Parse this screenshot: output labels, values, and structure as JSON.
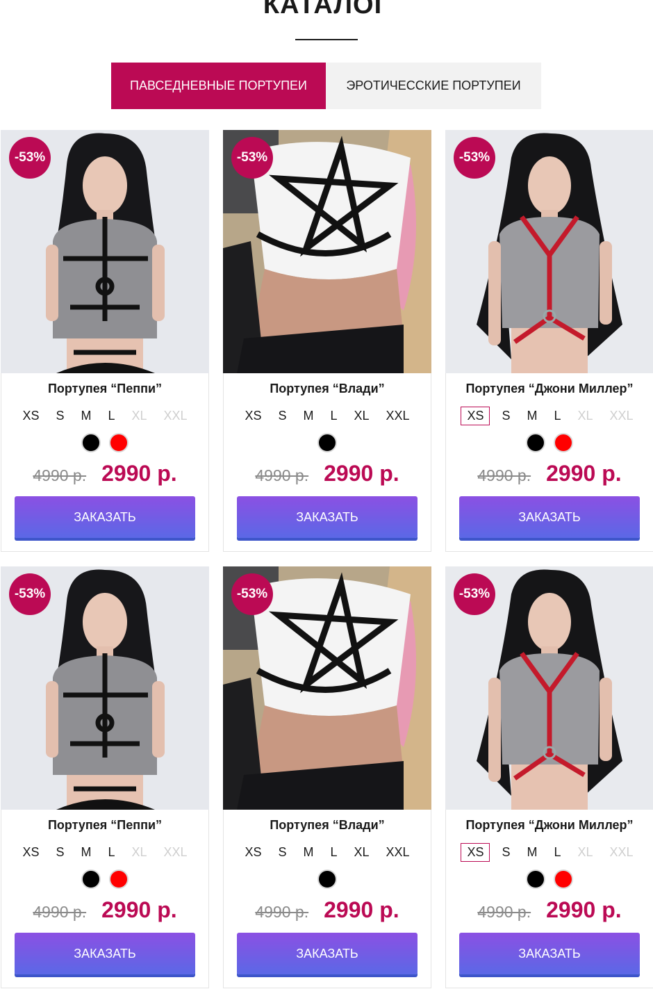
{
  "page": {
    "title": "КАТАЛОГ"
  },
  "tabs": [
    {
      "label": "ПАВСЕДНЕВНЫЕ ПОРТУПЕИ",
      "active": true
    },
    {
      "label": "ЭРОТИЧЕССКИЕ ПОРТУПЕИ",
      "active": false
    }
  ],
  "colors": {
    "accent": "#bb0a54",
    "button_top": "#8b50e3",
    "button_bottom": "#5b68e6"
  },
  "products": [
    {
      "discount": "-53%",
      "name": "Портупея “Пеппи”",
      "image": "model-gray-top-black-harness",
      "sizes": [
        {
          "label": "XS",
          "available": true,
          "selected": false
        },
        {
          "label": "S",
          "available": true,
          "selected": false
        },
        {
          "label": "M",
          "available": true,
          "selected": false
        },
        {
          "label": "L",
          "available": true,
          "selected": false
        },
        {
          "label": "XL",
          "available": false,
          "selected": false
        },
        {
          "label": "XXL",
          "available": false,
          "selected": false
        }
      ],
      "colors": [
        "#000000",
        "#ff0000"
      ],
      "old_price": "4990 р.",
      "new_price": "2990 р.",
      "button": "ЗАКАЗАТЬ"
    },
    {
      "discount": "-53%",
      "name": "Портупея “Влади”",
      "image": "model-white-top-pentagram-harness",
      "sizes": [
        {
          "label": "XS",
          "available": true,
          "selected": false
        },
        {
          "label": "S",
          "available": true,
          "selected": false
        },
        {
          "label": "M",
          "available": true,
          "selected": false
        },
        {
          "label": "L",
          "available": true,
          "selected": false
        },
        {
          "label": "XL",
          "available": true,
          "selected": false
        },
        {
          "label": "XXL",
          "available": true,
          "selected": false
        }
      ],
      "colors": [
        "#000000"
      ],
      "old_price": "4990 р.",
      "new_price": "2990 р.",
      "button": "ЗАКАЗАТЬ"
    },
    {
      "discount": "-53%",
      "name": "Портупея “Джони Миллер”",
      "image": "model-gray-top-red-harness",
      "sizes": [
        {
          "label": "XS",
          "available": true,
          "selected": true
        },
        {
          "label": "S",
          "available": true,
          "selected": false
        },
        {
          "label": "M",
          "available": true,
          "selected": false
        },
        {
          "label": "L",
          "available": true,
          "selected": false
        },
        {
          "label": "XL",
          "available": false,
          "selected": false
        },
        {
          "label": "XXL",
          "available": false,
          "selected": false
        }
      ],
      "colors": [
        "#000000",
        "#ff0000"
      ],
      "old_price": "4990 р.",
      "new_price": "2990 р.",
      "button": "ЗАКАЗАТЬ"
    },
    {
      "discount": "-53%",
      "name": "Портупея “Пеппи”",
      "image": "model-gray-top-black-harness",
      "sizes": [
        {
          "label": "XS",
          "available": true,
          "selected": false
        },
        {
          "label": "S",
          "available": true,
          "selected": false
        },
        {
          "label": "M",
          "available": true,
          "selected": false
        },
        {
          "label": "L",
          "available": true,
          "selected": false
        },
        {
          "label": "XL",
          "available": false,
          "selected": false
        },
        {
          "label": "XXL",
          "available": false,
          "selected": false
        }
      ],
      "colors": [
        "#000000",
        "#ff0000"
      ],
      "old_price": "4990 р.",
      "new_price": "2990 р.",
      "button": "ЗАКАЗАТЬ"
    },
    {
      "discount": "-53%",
      "name": "Портупея “Влади”",
      "image": "model-white-top-pentagram-harness",
      "sizes": [
        {
          "label": "XS",
          "available": true,
          "selected": false
        },
        {
          "label": "S",
          "available": true,
          "selected": false
        },
        {
          "label": "M",
          "available": true,
          "selected": false
        },
        {
          "label": "L",
          "available": true,
          "selected": false
        },
        {
          "label": "XL",
          "available": true,
          "selected": false
        },
        {
          "label": "XXL",
          "available": true,
          "selected": false
        }
      ],
      "colors": [
        "#000000"
      ],
      "old_price": "4990 р.",
      "new_price": "2990 р.",
      "button": "ЗАКАЗАТЬ"
    },
    {
      "discount": "-53%",
      "name": "Портупея “Джони Миллер”",
      "image": "model-gray-top-red-harness",
      "sizes": [
        {
          "label": "XS",
          "available": true,
          "selected": true
        },
        {
          "label": "S",
          "available": true,
          "selected": false
        },
        {
          "label": "M",
          "available": true,
          "selected": false
        },
        {
          "label": "L",
          "available": true,
          "selected": false
        },
        {
          "label": "XL",
          "available": false,
          "selected": false
        },
        {
          "label": "XXL",
          "available": false,
          "selected": false
        }
      ],
      "colors": [
        "#000000",
        "#ff0000"
      ],
      "old_price": "4990 р.",
      "new_price": "2990 р.",
      "button": "ЗАКАЗАТЬ"
    }
  ]
}
